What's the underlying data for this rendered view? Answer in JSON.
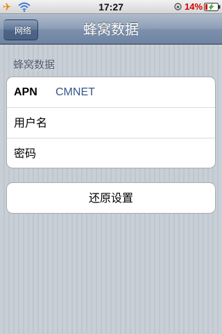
{
  "status_bar": {
    "time": "17:27",
    "battery_percent": "14%",
    "icons": [
      "airplane-icon",
      "wifi-icon",
      "orientation-lock-icon",
      "battery-charging-icon"
    ],
    "battery_text_color": "#d40000"
  },
  "nav": {
    "back_label": "网络",
    "title": "蜂窝数据"
  },
  "section": {
    "header": "蜂窝数据"
  },
  "apn_group": {
    "rows": [
      {
        "label": "APN",
        "value": "CMNET"
      },
      {
        "label": "用户名",
        "value": ""
      },
      {
        "label": "密码",
        "value": ""
      }
    ]
  },
  "reset": {
    "label": "还原设置"
  },
  "colors": {
    "nav_bar": "#6d84a2",
    "value_text": "#385487",
    "background": "#c5ccd4"
  }
}
